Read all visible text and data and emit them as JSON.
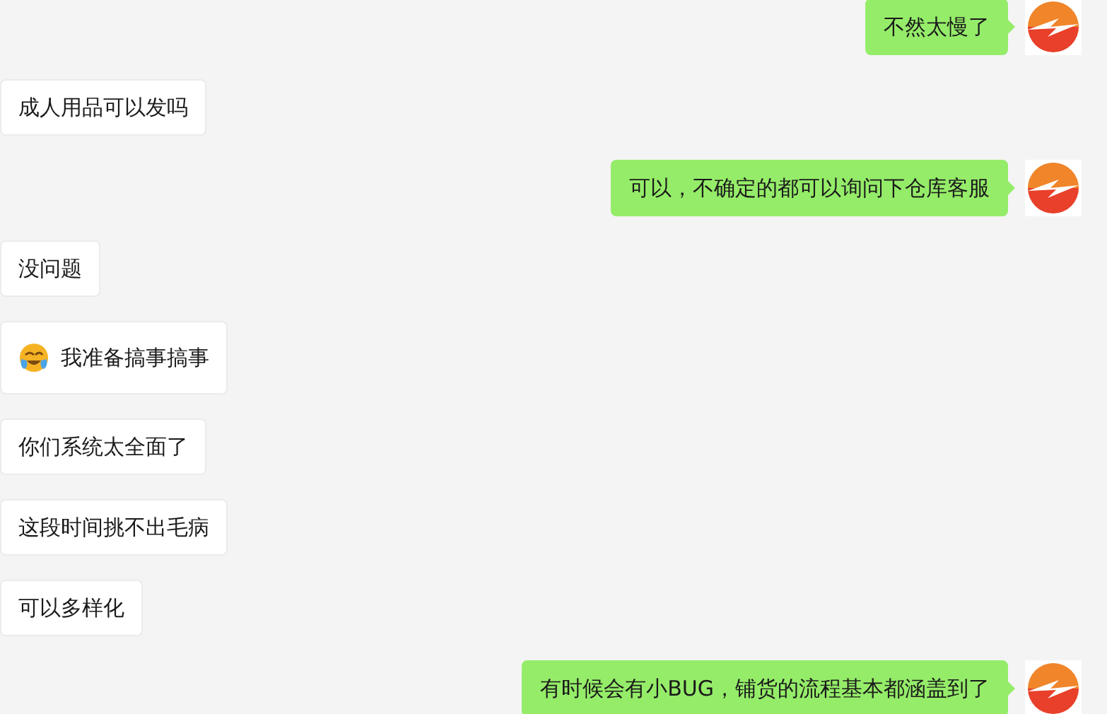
{
  "messages": [
    {
      "kind": "sent",
      "text": "不然太慢了"
    },
    {
      "kind": "received",
      "text": "成人用品可以发吗"
    },
    {
      "kind": "sent",
      "text": "可以，不确定的都可以询问下仓库客服"
    },
    {
      "kind": "received",
      "text": "没问题"
    },
    {
      "kind": "received",
      "text": "我准备搞事搞事",
      "emoji": true
    },
    {
      "kind": "received",
      "text": "你们系统太全面了"
    },
    {
      "kind": "received",
      "text": "这段时间挑不出毛病"
    },
    {
      "kind": "received",
      "text": "可以多样化"
    },
    {
      "kind": "sent",
      "text": "有时候会有小BUG，铺货的流程基本都涵盖到了"
    }
  ]
}
